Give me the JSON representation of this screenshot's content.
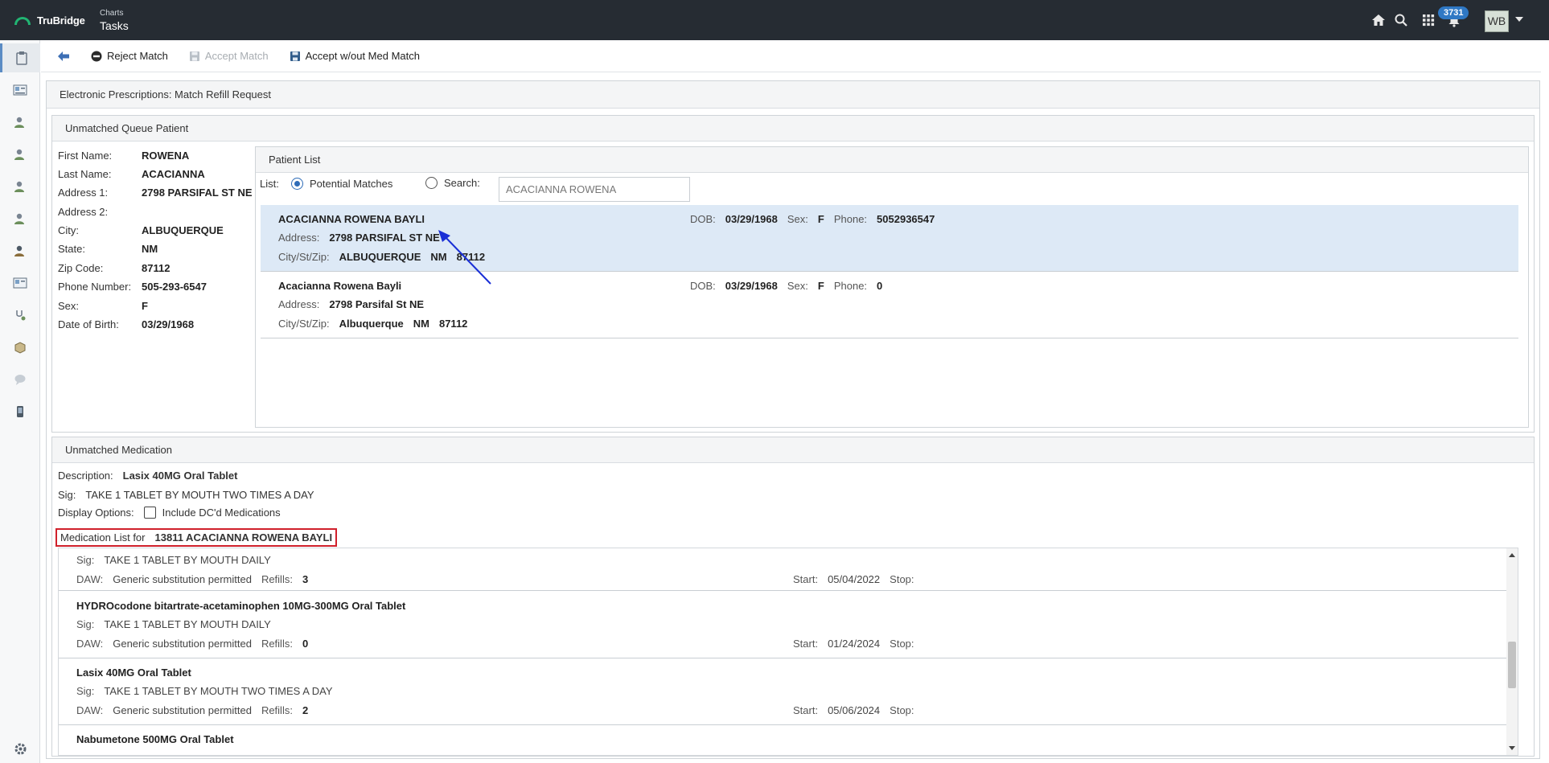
{
  "topbar": {
    "brand": "TruBridge",
    "crumb_small": "Charts",
    "crumb_big": "Tasks",
    "notification_count": "3731",
    "avatar_initials": "WB",
    "icons": [
      "home-icon",
      "search-icon",
      "apps-grid-icon",
      "bell-icon",
      "chevron-down-icon"
    ]
  },
  "toolbar": {
    "reject_label": "Reject Match",
    "accept_label": "Accept Match",
    "accept_without_label": "Accept w/out Med Match"
  },
  "frame_title": "Electronic Prescriptions: Match Refill Request",
  "unmatched_patient": {
    "title": "Unmatched Queue Patient",
    "fields": [
      {
        "label": "First Name:",
        "value": "ROWENA"
      },
      {
        "label": "Last Name:",
        "value": "ACACIANNA"
      },
      {
        "label": "Address 1:",
        "value": "2798 PARSIFAL ST NE"
      },
      {
        "label": "Address 2:",
        "value": ""
      },
      {
        "label": "City:",
        "value": "ALBUQUERQUE"
      },
      {
        "label": "State:",
        "value": "NM"
      },
      {
        "label": "Zip Code:",
        "value": "87112"
      },
      {
        "label": "Phone Number:",
        "value": "505-293-6547"
      },
      {
        "label": "Sex:",
        "value": "F"
      },
      {
        "label": "Date of Birth:",
        "value": "03/29/1968"
      }
    ]
  },
  "patient_list": {
    "title": "Patient List",
    "list_label": "List:",
    "option_potential": "Potential Matches",
    "option_search": "Search:",
    "search_value": "ACACIANNA ROWENA",
    "labels": {
      "address": "Address:",
      "city": "City/St/Zip:",
      "dob": "DOB:",
      "sex": "Sex:",
      "phone": "Phone:"
    },
    "matches": [
      {
        "name": "ACACIANNA ROWENA BAYLI",
        "address": "2798 PARSIFAL ST NE",
        "city": "ALBUQUERQUE",
        "state": "NM",
        "zip": "87112",
        "dob": "03/29/1968",
        "sex": "F",
        "phone": "5052936547"
      },
      {
        "name": "Acacianna Rowena Bayli",
        "address": "2798 Parsifal St NE",
        "city": "Albuquerque",
        "state": "NM",
        "zip": "87112",
        "dob": "03/29/1968",
        "sex": "F",
        "phone": "0"
      }
    ]
  },
  "unmatched_medication": {
    "title": "Unmatched Medication",
    "description_label": "Description:",
    "description_value": "Lasix 40MG Oral Tablet",
    "sig_label": "Sig:",
    "sig_value": "TAKE 1 TABLET BY MOUTH TWO TIMES A DAY",
    "display_options_label": "Display Options:",
    "include_dc_label": "Include DC'd Medications",
    "medlist_label": "Medication List for",
    "medlist_patient": "13811 ACACIANNA ROWENA BAYLI",
    "labels": {
      "sig": "Sig:",
      "daw": "DAW:",
      "refills": "Refills:",
      "start": "Start:",
      "stop": "Stop:"
    },
    "medications": [
      {
        "name": "",
        "sig": "TAKE 1 TABLET BY MOUTH DAILY",
        "daw": "Generic substitution permitted",
        "refills": "3",
        "start": "05/04/2022",
        "stop": ""
      },
      {
        "name": "HYDROcodone bitartrate-acetaminophen 10MG-300MG Oral Tablet",
        "sig": "TAKE 1 TABLET BY MOUTH DAILY",
        "daw": "Generic substitution permitted",
        "refills": "0",
        "start": "01/24/2024",
        "stop": ""
      },
      {
        "name": "Lasix 40MG Oral Tablet",
        "sig": "TAKE 1 TABLET BY MOUTH TWO TIMES A DAY",
        "daw": "Generic substitution permitted",
        "refills": "2",
        "start": "05/06/2024",
        "stop": ""
      },
      {
        "name": "Nabumetone 500MG Oral Tablet",
        "sig": "",
        "daw": "",
        "refills": "",
        "start": "",
        "stop": ""
      }
    ]
  }
}
